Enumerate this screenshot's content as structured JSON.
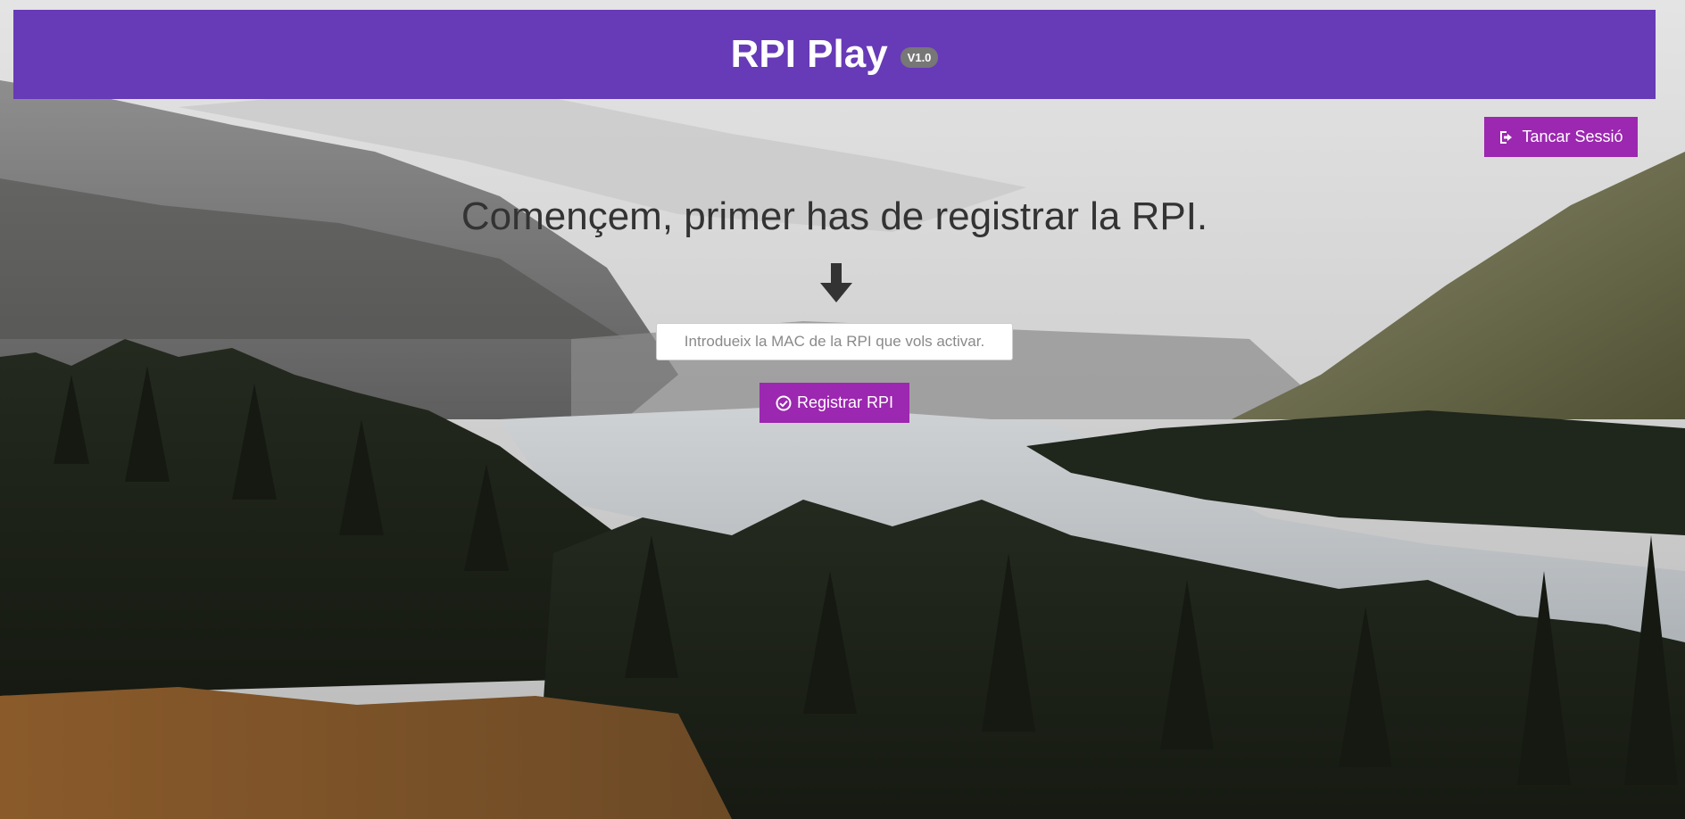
{
  "header": {
    "title": "RPI Play",
    "version_badge": "V1.0",
    "background_color": "#673ab7"
  },
  "actions": {
    "logout_label": "Tancar Sessió",
    "logout_icon": "sign-out-icon",
    "button_color": "#9c27b0"
  },
  "main": {
    "headline": "Començem, primer has de registrar la RPI.",
    "arrow_icon": "arrow-down-icon",
    "mac_input": {
      "value": "",
      "placeholder": "Introdueix la MAC de la RPI que vols activar."
    },
    "register_label": "Registrar RPI",
    "register_icon": "check-circle-icon"
  },
  "background": {
    "scene": "mountain-lake-forest-photo"
  }
}
